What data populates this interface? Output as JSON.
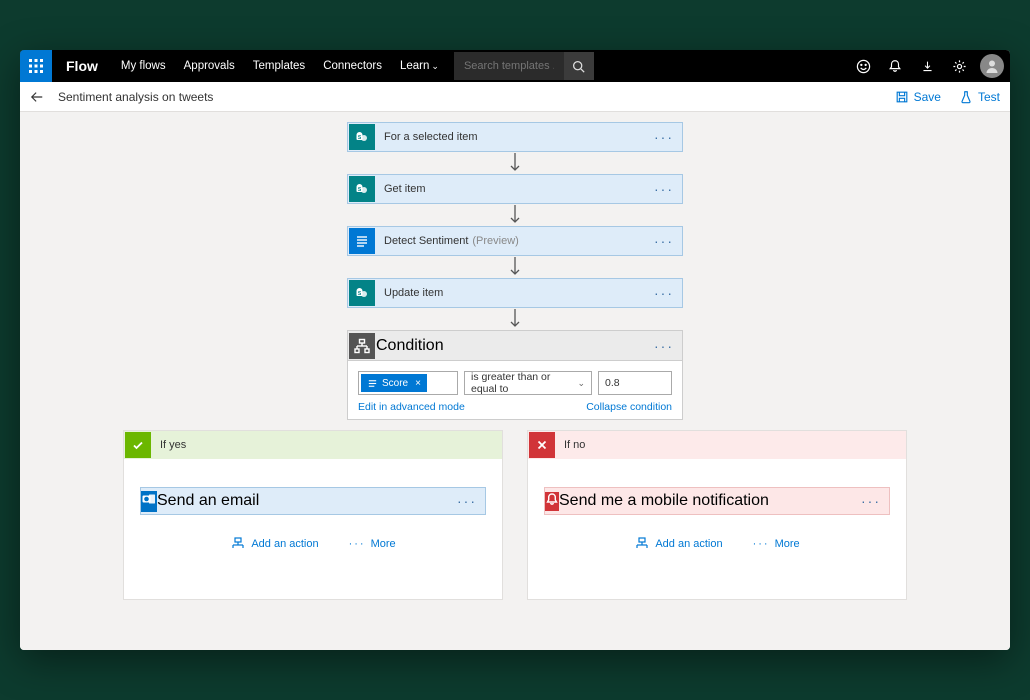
{
  "topbar": {
    "brand": "Flow",
    "nav": [
      "My flows",
      "Approvals",
      "Templates",
      "Connectors",
      "Learn"
    ],
    "search_placeholder": "Search templates ..."
  },
  "subbar": {
    "title": "Sentiment analysis on tweets",
    "save": "Save",
    "test": "Test"
  },
  "steps": [
    {
      "label": "For a selected item",
      "icon": "sharepoint"
    },
    {
      "label": "Get item",
      "icon": "sharepoint"
    },
    {
      "label": "Detect Sentiment",
      "suffix": "(Preview)",
      "icon": "text-analytics"
    },
    {
      "label": "Update item",
      "icon": "sharepoint"
    }
  ],
  "condition": {
    "title": "Condition",
    "token_label": "Score",
    "operator": "is greater than or equal to",
    "value": "0.8",
    "edit_link": "Edit in advanced mode",
    "collapse_link": "Collapse condition"
  },
  "branches": {
    "yes": {
      "title": "If yes",
      "action": "Send an email",
      "add": "Add an action",
      "more": "More"
    },
    "no": {
      "title": "If no",
      "action": "Send me a mobile notification",
      "add": "Add an action",
      "more": "More"
    }
  }
}
